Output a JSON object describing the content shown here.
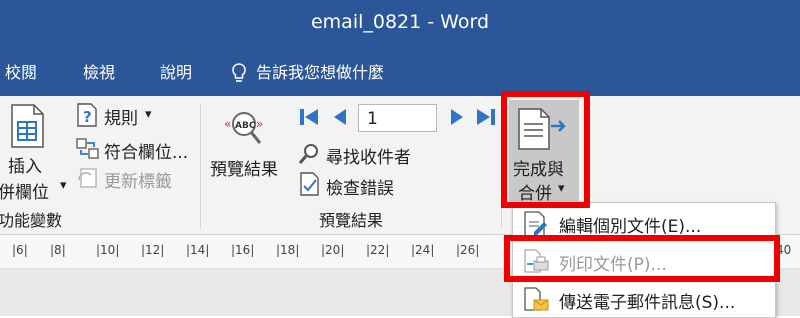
{
  "window": {
    "title": "email_0821  -  Word"
  },
  "tabs": [
    {
      "label": "校閱"
    },
    {
      "label": "檢視"
    },
    {
      "label": "說明"
    }
  ],
  "tellme": {
    "label": "告訴我您想做什麼",
    "icon": "lightbulb-icon"
  },
  "ribbon": {
    "insert_field": {
      "line1": "插入",
      "line2": "併欄位",
      "arrow": "▾"
    },
    "rules": {
      "label": "規則",
      "arrow": "▾",
      "icon": "rules-icon"
    },
    "match_fields": {
      "label": "符合欄位...",
      "icon": "match-fields-icon"
    },
    "update_labels": {
      "label": "更新標籤",
      "icon": "update-labels-icon"
    },
    "group_fields_label": "功能變數",
    "preview_results": {
      "label": "預覽結果",
      "icon": "abc-preview-icon"
    },
    "nav": {
      "first_icon": "first-record-icon",
      "prev_icon": "previous-record-icon",
      "record_value": "1",
      "next_icon": "next-record-icon",
      "last_icon": "last-record-icon"
    },
    "find_recipient": {
      "label": "尋找收件者",
      "icon": "find-recipient-icon"
    },
    "check_errors": {
      "label": "檢查錯誤",
      "icon": "check-errors-icon"
    },
    "group_preview_label": "預覽結果",
    "finish_merge": {
      "line1": "完成與",
      "line2": "合併",
      "arrow": "▾",
      "icon": "finish-merge-icon"
    }
  },
  "ruler": {
    "ticks": [
      "6",
      "8",
      "10",
      "12",
      "14",
      "16",
      "18",
      "20",
      "22",
      "24",
      "26",
      "40"
    ]
  },
  "menu": {
    "items": [
      {
        "label": "編輯個別文件(E)...",
        "icon": "edit-documents-icon",
        "disabled": false
      },
      {
        "label": "列印文件(P)...",
        "icon": "print-documents-icon",
        "disabled": true
      },
      {
        "label": "傳送電子郵件訊息(S)...",
        "icon": "send-email-icon",
        "disabled": false
      }
    ]
  },
  "colors": {
    "title_bar": "#2b579a",
    "highlight": "#f00000",
    "ribbon_bg": "#f3f3f3",
    "nav_blue": "#2e75c5"
  }
}
